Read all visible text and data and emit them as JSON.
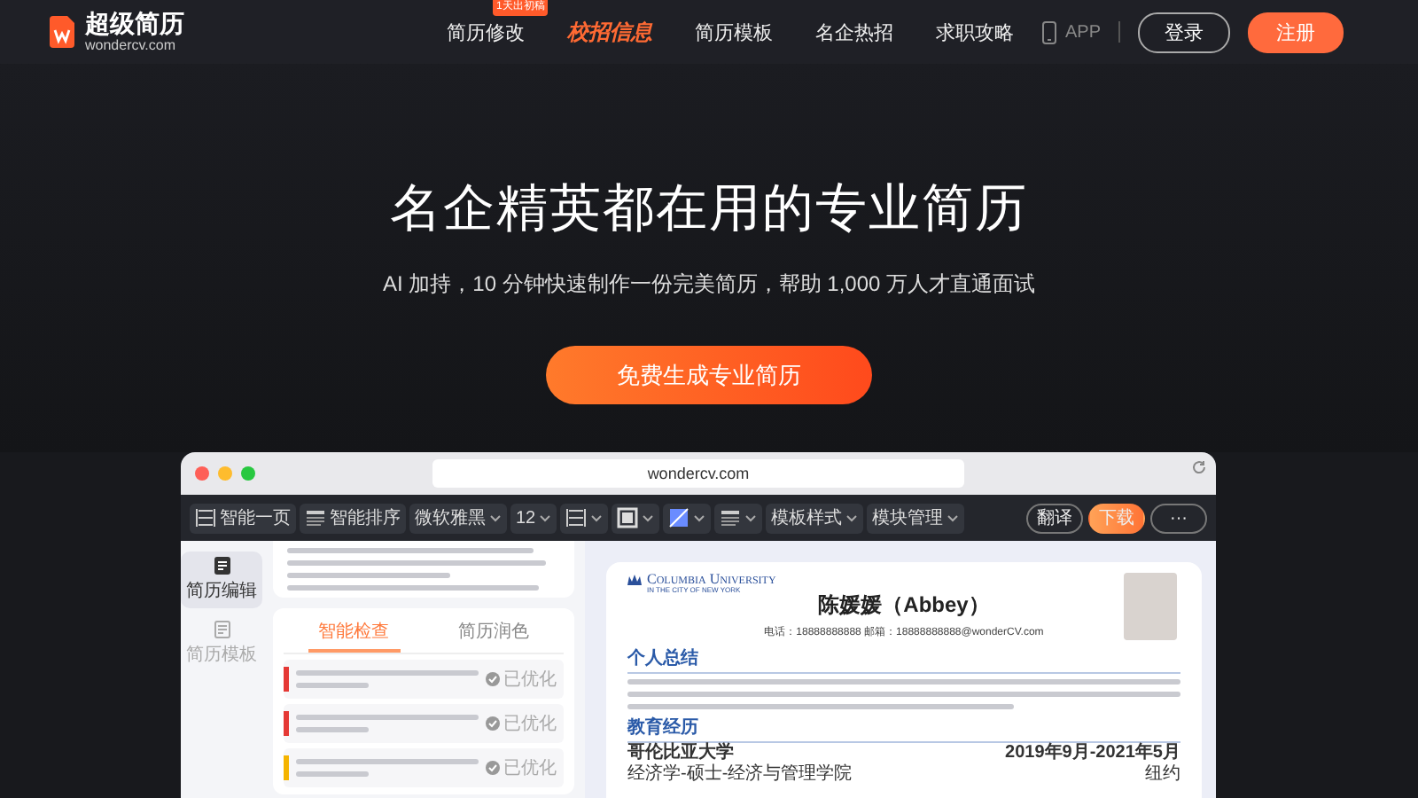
{
  "header": {
    "logo": {
      "title": "超级简历",
      "subtitle": "wondercv.com"
    },
    "nav": [
      {
        "label": "简历修改",
        "selected": false,
        "badge": "1天出初稿"
      },
      {
        "label": "校招信息",
        "selected": true
      },
      {
        "label": "简历模板",
        "selected": false
      },
      {
        "label": "名企热招",
        "selected": false
      },
      {
        "label": "求职攻略",
        "selected": false
      }
    ],
    "app": "APP",
    "login": "登录",
    "register": "注册"
  },
  "hero": {
    "title": "名企精英都在用的专业简历",
    "subtitle": "AI 加持，10 分钟快速制作一份完美简历，帮助 1,000 万人才直通面试",
    "cta": "免费生成专业简历"
  },
  "mockup": {
    "url": "wondercv.com",
    "toolbar": [
      {
        "kind": "button",
        "label": "智能一页"
      },
      {
        "kind": "button",
        "label": "智能排序"
      },
      {
        "kind": "dropdown",
        "label": "微软雅黑"
      },
      {
        "kind": "dropdown",
        "label": "12"
      },
      {
        "kind": "icon"
      },
      {
        "kind": "icon"
      },
      {
        "kind": "icon"
      },
      {
        "kind": "icon"
      },
      {
        "kind": "dropdown",
        "label": "模板样式"
      },
      {
        "kind": "dropdown",
        "label": "模块管理"
      }
    ],
    "actions": [
      {
        "kind": "outline",
        "label": "翻译"
      },
      {
        "kind": "primary",
        "label": "下载"
      },
      {
        "kind": "outline",
        "label": "···"
      }
    ],
    "sidebar": [
      {
        "label": "简历编辑",
        "selected": true
      },
      {
        "label": "简历模板",
        "selected": false
      }
    ],
    "check_tabs": [
      {
        "label": "智能检查",
        "selected": true
      },
      {
        "label": "简历润色",
        "selected": false
      }
    ],
    "checks": [
      {
        "color": "#e53935",
        "status": "已优化"
      },
      {
        "color": "#e53935",
        "status": "已优化"
      },
      {
        "color": "#f5b400",
        "status": "已优化"
      }
    ],
    "resume": {
      "school_logo": "Columbia University",
      "school_tagline": "IN THE CITY OF NEW YORK",
      "name": "陈媛媛（Abbey）",
      "contact": "电话：18888888888   邮箱：18888888888@wonderCV.com",
      "sections": [
        {
          "heading": "个人总结"
        },
        {
          "heading": "教育经历",
          "rows": [
            {
              "left": "哥伦比亚大学",
              "right": "2019年9月-2021年5月",
              "bold": true
            },
            {
              "left": "经济学-硕士-经济与管理学院",
              "right": "纽约",
              "bold": false
            }
          ]
        }
      ]
    }
  }
}
